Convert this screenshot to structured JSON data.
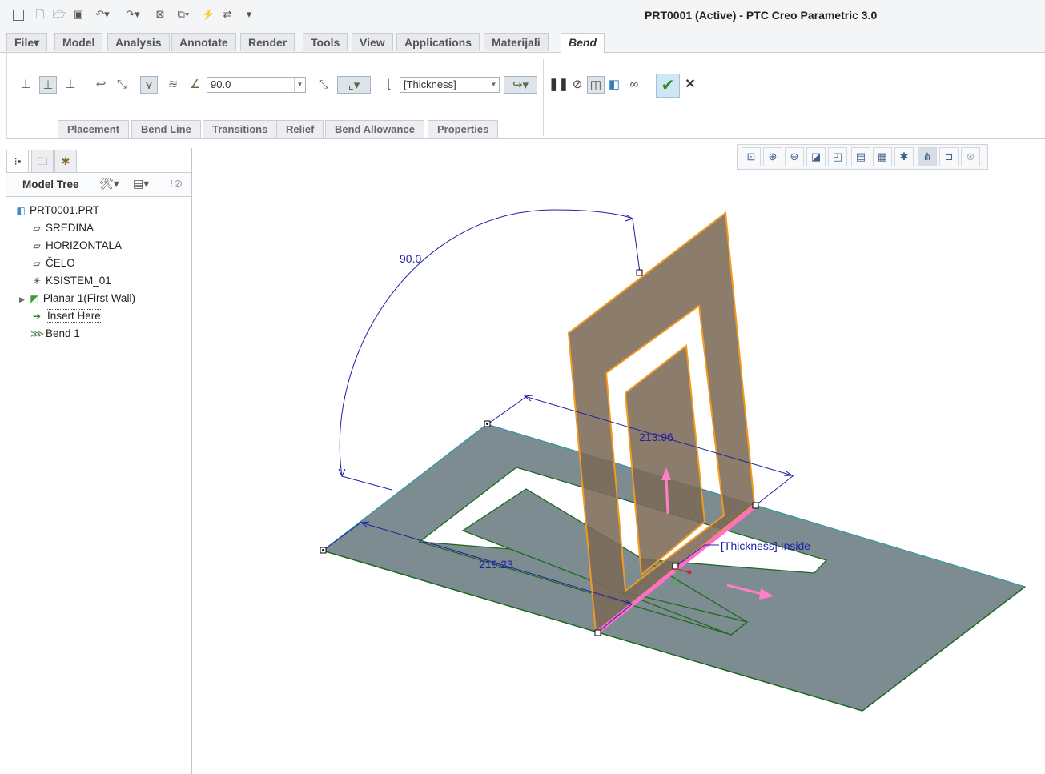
{
  "window": {
    "title": "PRT0001 (Active) - PTC Creo Parametric 3.0"
  },
  "quick_access": {
    "icons": [
      "window-icon",
      "new-icon",
      "open-icon",
      "save-icon",
      "undo-icon",
      "redo-icon",
      "close-window-icon",
      "windows-icon",
      "regenerate-icon",
      "switch-windows-icon",
      "customize-icon"
    ]
  },
  "menu": {
    "file": "File",
    "tabs": [
      "Model",
      "Analysis",
      "Annotate",
      "Render",
      "Tools",
      "View",
      "Applications",
      "Materijali"
    ],
    "active_tab": "Bend"
  },
  "ribbon": {
    "angle_value": "90.0",
    "radius_value": "[Thickness]",
    "subtabs": [
      "Placement",
      "Bend Line",
      "Transitions",
      "Relief",
      "Bend Allowance",
      "Properties"
    ],
    "ok_icon": "checkmark-icon",
    "cancel_icon": "close-icon"
  },
  "model_tree": {
    "title": "Model Tree",
    "items": [
      {
        "label": "PRT0001.PRT",
        "icon": "part-icon"
      },
      {
        "label": "SREDINA",
        "icon": "datum-plane-icon"
      },
      {
        "label": "HORIZONTALA",
        "icon": "datum-plane-icon"
      },
      {
        "label": "ČELO",
        "icon": "datum-plane-icon"
      },
      {
        "label": "KSISTEM_01",
        "icon": "coordinate-system-icon"
      },
      {
        "label": "Planar 1(First Wall)",
        "icon": "planar-wall-icon"
      },
      {
        "label": "Insert Here",
        "icon": "insert-arrow-icon"
      },
      {
        "label": "Bend 1",
        "icon": "bend-icon"
      }
    ]
  },
  "graphics": {
    "dim_angle": "90.0",
    "dim_top": "213.96",
    "dim_bottom": "219.23",
    "radius_note": "[Thickness] Inside",
    "colors": {
      "sheet": "#7d8c90",
      "bent_wall": "#7b6a58",
      "edge_orange": "#f39a1e",
      "bend_line": "#ff6fc6",
      "dimension": "#1f1fa6"
    }
  }
}
